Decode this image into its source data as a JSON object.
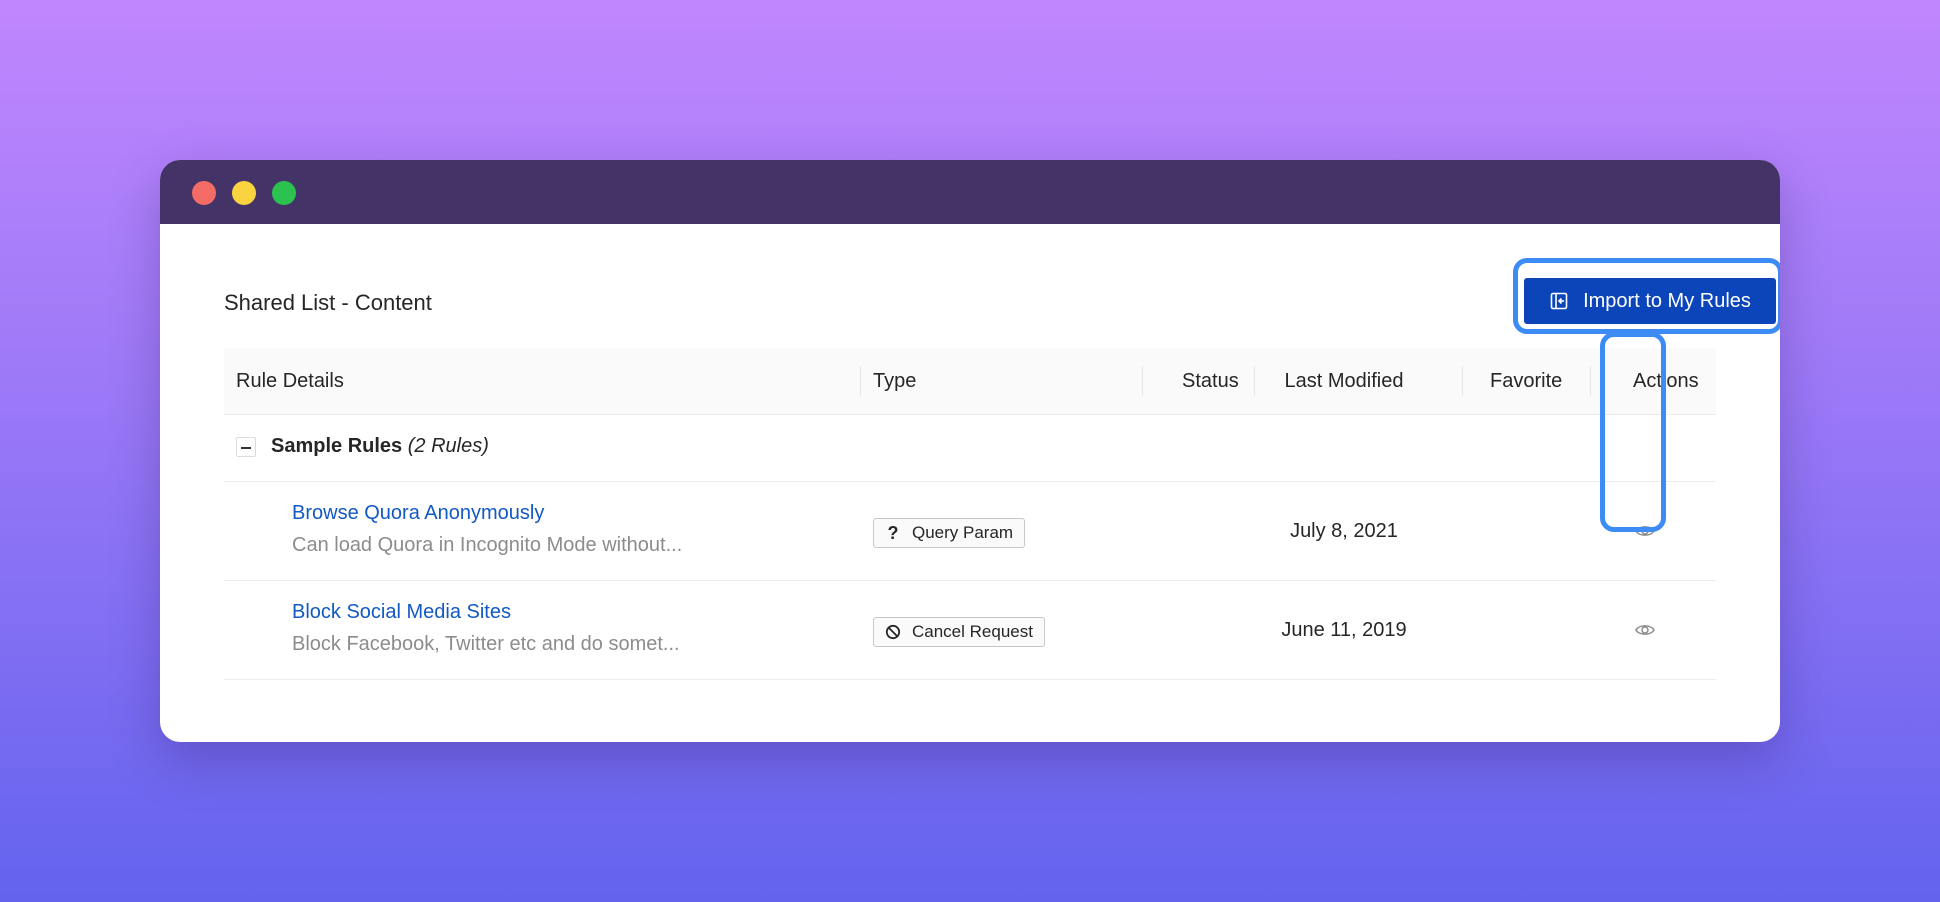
{
  "window": {
    "controls": [
      "close",
      "minimize",
      "maximize"
    ]
  },
  "page": {
    "title": "Shared List - Content",
    "import_button": {
      "label": "Import to My Rules",
      "icon": "import-icon"
    }
  },
  "table": {
    "columns": {
      "rule_details": "Rule Details",
      "type": "Type",
      "status": "Status",
      "last_modified": "Last Modified",
      "favorite": "Favorite",
      "actions": "Actions"
    },
    "group": {
      "name": "Sample Rules",
      "count": "(2 Rules)",
      "collapse_icon": "minus-icon"
    },
    "rows": [
      {
        "name": "Browse Quora Anonymously",
        "description": "Can load Quora in Incognito Mode without...",
        "type": "Query Param",
        "type_icon": "question-icon",
        "last_modified": "July 8, 2021",
        "action_icon": "eye-icon"
      },
      {
        "name": "Block Social Media Sites",
        "description": "Block Facebook, Twitter etc and do somet...",
        "type": "Cancel Request",
        "type_icon": "block-icon",
        "last_modified": "June 11, 2019",
        "action_icon": "eye-icon"
      }
    ]
  },
  "colors": {
    "titlebar": "#433366",
    "primary_button": "#0b45b9",
    "link": "#1259c3",
    "highlight": "#3d8bf5"
  }
}
